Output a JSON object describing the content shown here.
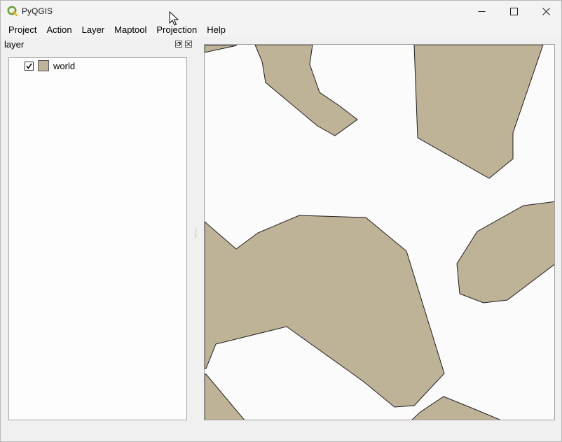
{
  "window": {
    "title": "PyQGIS",
    "app_icon": "qgis-icon",
    "controls": [
      "minimize-icon",
      "maximize-icon",
      "close-icon"
    ]
  },
  "menubar": {
    "items": [
      {
        "label": "Project"
      },
      {
        "label": "Action"
      },
      {
        "label": "Layer"
      },
      {
        "label": "Maptool"
      },
      {
        "label": "Projection"
      },
      {
        "label": "Help"
      }
    ]
  },
  "dock": {
    "title": "layer",
    "layers": [
      {
        "name": "world",
        "checked": true,
        "fill_color": "#beb297"
      }
    ]
  },
  "map": {
    "background": "#fbfbfb",
    "polygon_fill": "#beb297",
    "polygon_stroke": "#1e1e1e"
  }
}
